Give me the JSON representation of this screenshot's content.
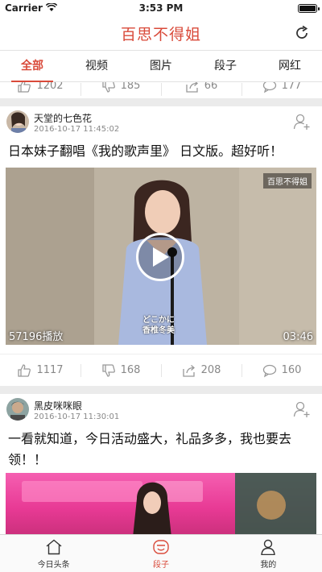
{
  "status": {
    "carrier": "Carrier",
    "time": "3:53 PM",
    "battery_level": 1.0
  },
  "nav": {
    "title": "百思不得姐",
    "refresh_icon": "refresh-icon"
  },
  "tabs": [
    {
      "label": "全部",
      "active": true
    },
    {
      "label": "视频",
      "active": false
    },
    {
      "label": "图片",
      "active": false
    },
    {
      "label": "段子",
      "active": false
    },
    {
      "label": "网红",
      "active": false
    }
  ],
  "prev_actions": {
    "likes": "1202",
    "dislikes": "185",
    "shares": "66",
    "comments": "177"
  },
  "posts": [
    {
      "author": "天堂的七色花",
      "time": "2016-10-17 11:45:02",
      "text": "日本妹子翻唱《我的歌声里》 日文版。超好听！",
      "video": {
        "watermark": "百思不得姐",
        "play_count": "57196播放",
        "duration": "03:46",
        "subtitle_line1": "どこかに",
        "subtitle_line2": "香椎冬美"
      },
      "actions": {
        "likes": "1117",
        "dislikes": "168",
        "shares": "208",
        "comments": "160"
      }
    },
    {
      "author": "黑皮咪咪眼",
      "time": "2016-10-17 11:30:01",
      "text": "一看就知道，今日活动盛大，礼品多多，我也要去领！！"
    }
  ],
  "tab_bar": [
    {
      "label": "今日头条",
      "icon": "home-icon",
      "active": false
    },
    {
      "label": "段子",
      "icon": "joke-icon",
      "active": true
    },
    {
      "label": "我的",
      "icon": "profile-icon",
      "active": false
    }
  ],
  "colors": {
    "accent": "#d94a3a",
    "background": "#ebebeb"
  }
}
